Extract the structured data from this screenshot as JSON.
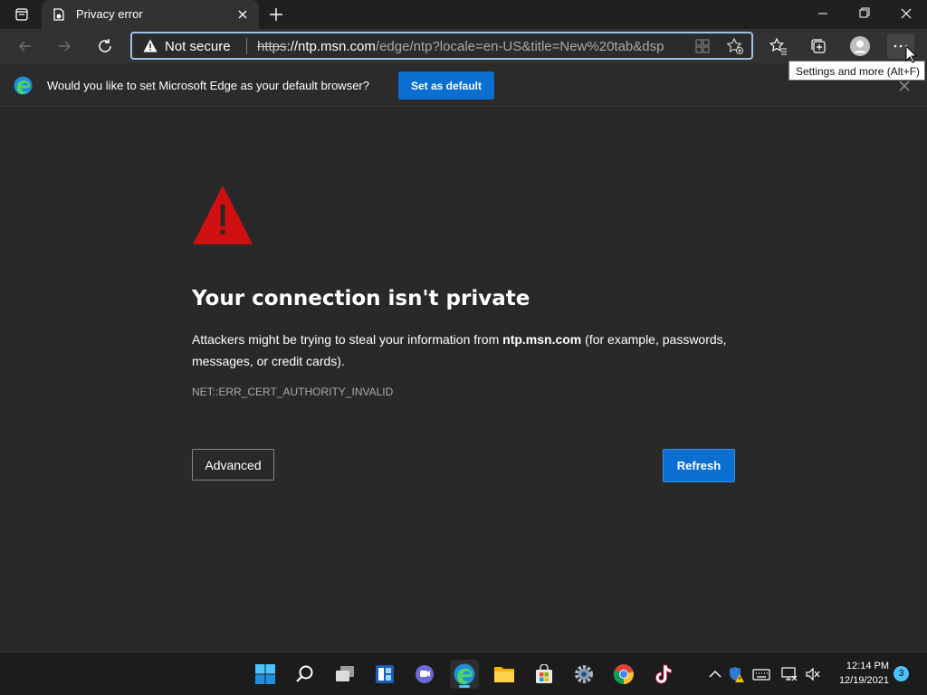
{
  "tab": {
    "title": "Privacy error"
  },
  "address": {
    "security_label": "Not secure",
    "url_scheme": "https",
    "url_host": "://ntp.msn.com",
    "url_path": "/edge/ntp?locale=en-US&title=New%20tab&dsp"
  },
  "infobar": {
    "message": "Would you like to set Microsoft Edge as your default browser?",
    "button_label": "Set as default"
  },
  "tooltip": {
    "text": "Settings and more (Alt+F)"
  },
  "error_page": {
    "heading": "Your connection isn't private",
    "desc_before": "Attackers might be trying to steal your information from ",
    "desc_host": "ntp.msn.com",
    "desc_after": " (for example, passwords, messages, or credit cards).",
    "error_code": "NET::ERR_CERT_AUTHORITY_INVALID",
    "advanced_label": "Advanced",
    "refresh_label": "Refresh"
  },
  "taskbar": {
    "time": "12:14 PM",
    "date": "12/19/2021",
    "notification_count": "3"
  },
  "colors": {
    "accent": "#0a6fd0",
    "warning_red": "#d01010",
    "background": "#292929"
  }
}
